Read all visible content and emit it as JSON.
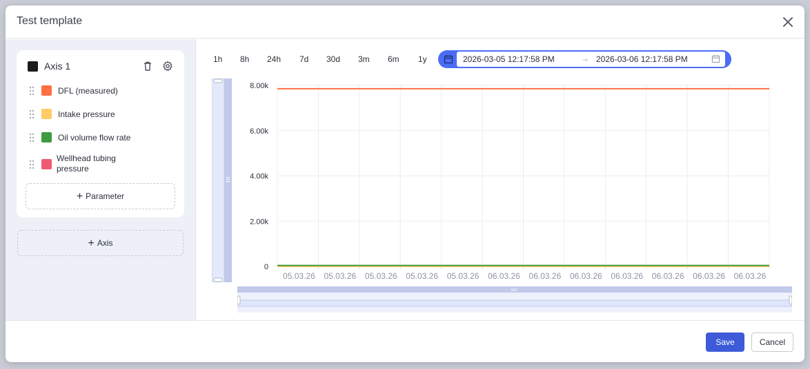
{
  "modal": {
    "title": "Test template"
  },
  "sidebar": {
    "axis": {
      "title": "Axis 1",
      "swatch_color": "#1c1c1e"
    },
    "parameters": [
      {
        "label": "DFL (measured)",
        "color": "#ff7043"
      },
      {
        "label": "Intake pressure",
        "color": "#ffcc66"
      },
      {
        "label": "Oil volume flow rate",
        "color": "#3f9b3f"
      },
      {
        "label": "Wellhead tubing pressure",
        "color": "#ef5a73"
      }
    ],
    "add_parameter_label": "Parameter",
    "add_axis_label": "Axis"
  },
  "toolbar": {
    "ranges": [
      "1h",
      "8h",
      "24h",
      "7d",
      "30d",
      "3m",
      "6m",
      "1y"
    ],
    "date_from": "2026-03-05 12:17:58 PM",
    "date_to": "2026-03-06 12:17:58 PM",
    "arrow": "→"
  },
  "chart_data": {
    "type": "line",
    "yticks": [
      "8.00k",
      "6.00k",
      "4.00k",
      "2.00k",
      "0"
    ],
    "ylim": [
      0,
      8000
    ],
    "xticks": [
      "05.03.26",
      "05.03.26",
      "05.03.26",
      "05.03.26",
      "05.03.26",
      "06.03.26",
      "06.03.26",
      "06.03.26",
      "06.03.26",
      "06.03.26",
      "06.03.26",
      "06.03.26"
    ],
    "grid": true,
    "series": [
      {
        "color": "#ff7043",
        "values": [
          7850,
          7850
        ]
      },
      {
        "color": "#ffcc66",
        "values": [
          0,
          0
        ]
      },
      {
        "color": "#3f9b3f",
        "values": [
          40,
          40
        ]
      },
      {
        "color": "#ef5a73",
        "values": [
          0,
          0
        ]
      }
    ]
  },
  "footer": {
    "save_label": "Save",
    "cancel_label": "Cancel"
  }
}
